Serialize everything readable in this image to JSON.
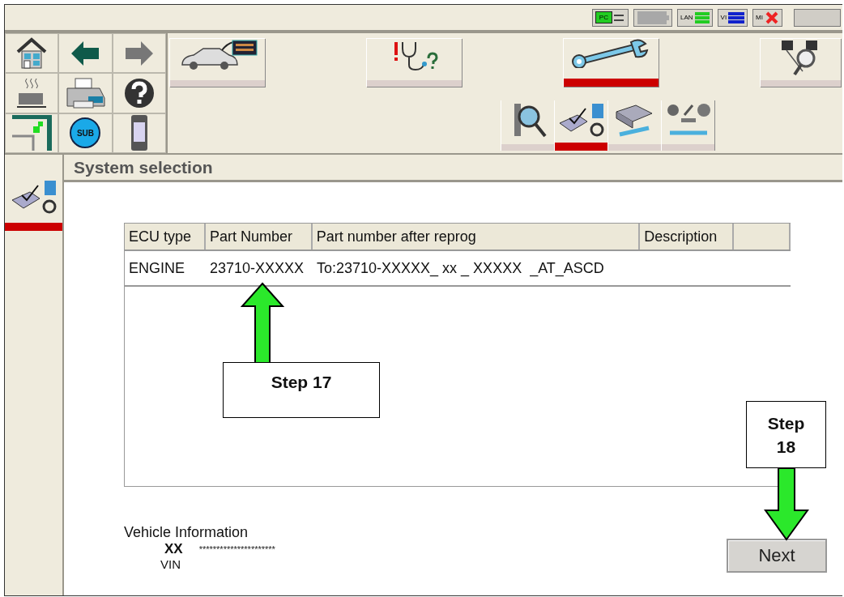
{
  "status_bar": {
    "indicators": [
      {
        "kind": "pc",
        "label": "PC"
      },
      {
        "kind": "battery"
      },
      {
        "kind": "lan",
        "label": "LAN"
      },
      {
        "kind": "vi",
        "label": "VI"
      },
      {
        "kind": "mi",
        "label": "MI"
      },
      {
        "kind": "blank"
      }
    ]
  },
  "toolbar": {
    "sub_label": "SUB",
    "modes": [
      {
        "kind": "vehicle",
        "selected": false
      },
      {
        "kind": "diagnosis",
        "selected": false
      },
      {
        "kind": "repair",
        "selected": true
      },
      {
        "kind": "support",
        "selected": false
      }
    ],
    "submodes": [
      {
        "kind": "inspect",
        "selected": false
      },
      {
        "kind": "reprogram",
        "selected": true
      },
      {
        "kind": "ecu",
        "selected": false
      },
      {
        "kind": "parts",
        "selected": false
      }
    ]
  },
  "sidebar": {
    "items": [
      {
        "kind": "reprogram",
        "selected": true
      }
    ]
  },
  "title": "System selection",
  "table": {
    "columns": [
      "ECU type",
      "Part Number",
      "Part number after reprog",
      "Description"
    ],
    "rows": [
      {
        "cells": [
          "ENGINE",
          "23710-XXXXX",
          "To:23710-XXXXX_ xx _ XXXXX  _AT_ASCD"
        ]
      }
    ]
  },
  "vehicle_info": {
    "title": "Vehicle Information",
    "model_label": "XX",
    "model_value": "**********************",
    "vin_label": "VIN"
  },
  "buttons": [
    {
      "label": "Next"
    }
  ],
  "annotations": [
    {
      "kind": "up-arrow",
      "label": "Step 17"
    },
    {
      "kind": "down-arrow",
      "label": "Step 18"
    }
  ]
}
